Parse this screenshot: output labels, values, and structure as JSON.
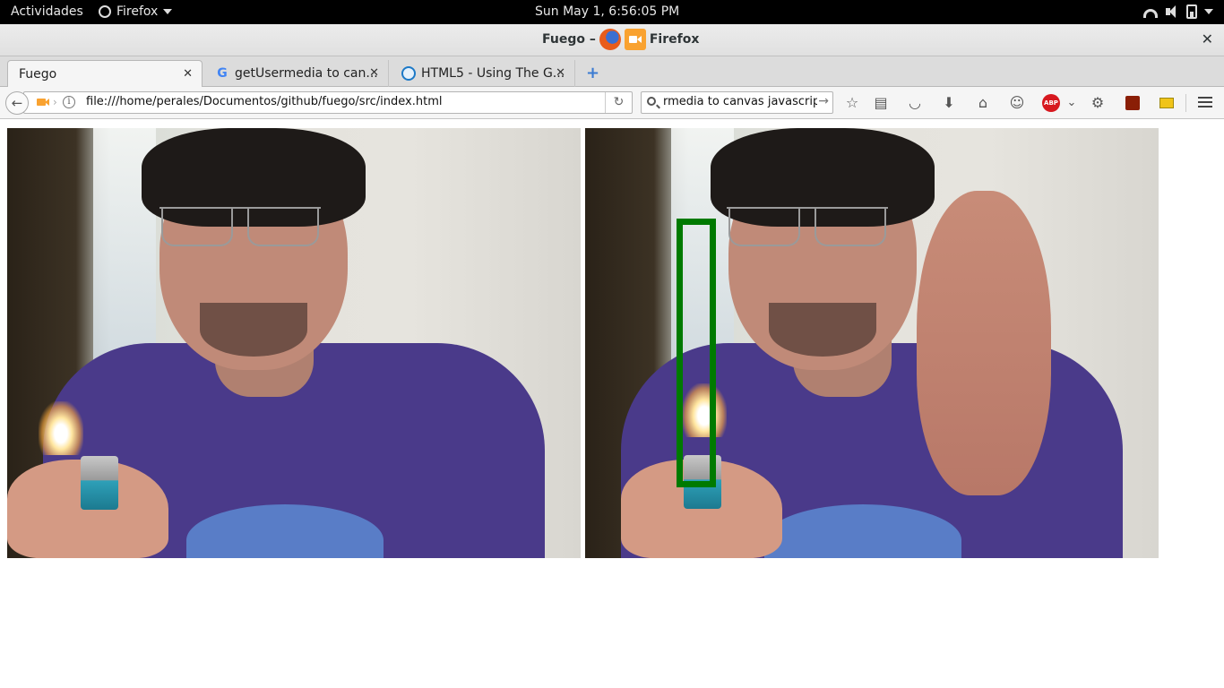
{
  "topbar": {
    "activities": "Actividades",
    "app_name": "Firefox",
    "clock": "Sun May  1,  6:56:05 PM",
    "icons": [
      "wifi-icon",
      "volume-muted-icon",
      "battery-icon"
    ]
  },
  "window": {
    "title_left": "Fuego –",
    "title_right": "Firefox",
    "close": "✕"
  },
  "tabs": [
    {
      "label": "Fuego",
      "favicon": "none",
      "active": true
    },
    {
      "label": "getUsermedia to can...",
      "favicon": "google-icon",
      "active": false
    },
    {
      "label": "HTML5 - Using The G...",
      "favicon": "intel-icon",
      "active": false
    }
  ],
  "tab_close": "✕",
  "new_tab": "+",
  "navbar": {
    "url": "file:///home/perales/Documentos/github/fuego/src/index.html",
    "search_value": "rmedia to canvas javascript",
    "back": "←",
    "reload": "↻",
    "go": "→",
    "info": "i"
  },
  "toolbar_icons": [
    {
      "name": "bookmark-star-icon",
      "glyph": "☆"
    },
    {
      "name": "reading-list-icon",
      "glyph": "▤"
    },
    {
      "name": "pocket-icon",
      "glyph": "◡"
    },
    {
      "name": "downloads-icon",
      "glyph": "⬇"
    },
    {
      "name": "home-icon",
      "glyph": "⌂"
    },
    {
      "name": "chat-icon",
      "glyph": "☺"
    },
    {
      "name": "adblock-icon",
      "glyph": "ABP"
    },
    {
      "name": "adblock-dropdown-icon",
      "glyph": "⌄"
    },
    {
      "name": "extension-icon",
      "glyph": "⚙"
    },
    {
      "name": "firebug-icon",
      "glyph": ""
    },
    {
      "name": "notes-icon",
      "glyph": ""
    },
    {
      "name": "menu-icon",
      "glyph": ""
    }
  ],
  "detection": {
    "box_color": "#007a00"
  }
}
